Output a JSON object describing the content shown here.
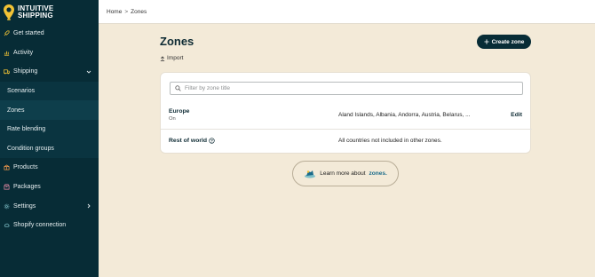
{
  "brand": {
    "line1": "INTUITIVE",
    "line2": "SHIPPING"
  },
  "sidebar": {
    "items": [
      {
        "label": "Get started",
        "icon": "rocket-icon"
      },
      {
        "label": "Activity",
        "icon": "chart-icon"
      },
      {
        "label": "Shipping",
        "icon": "truck-icon",
        "expanded": true
      },
      {
        "label": "Scenarios"
      },
      {
        "label": "Zones",
        "active": true
      },
      {
        "label": "Rate blending"
      },
      {
        "label": "Condition groups"
      },
      {
        "label": "Products",
        "icon": "gift-icon"
      },
      {
        "label": "Packages",
        "icon": "package-icon"
      },
      {
        "label": "Settings",
        "icon": "gear-icon"
      },
      {
        "label": "Shopify connection",
        "icon": "cloud-link-icon"
      }
    ]
  },
  "breadcrumb": {
    "home": "Home",
    "separator": ">",
    "current": "Zones"
  },
  "page": {
    "title": "Zones",
    "import_label": "Import",
    "create_label": "Create zone"
  },
  "search": {
    "placeholder": "Filter by zone title",
    "value": ""
  },
  "zones": [
    {
      "name": "Europe",
      "status": "On",
      "countries": "Aland Islands, Albania, Andorra, Austria, Belarus, ...",
      "action": "Edit"
    },
    {
      "name": "Rest of world",
      "status": "",
      "countries": "All countries not included in other zones.",
      "action": ""
    }
  ],
  "learn_more": {
    "text": "Learn more about",
    "link": "zones."
  },
  "colors": {
    "sidebar": "#072c36",
    "background": "#f3ead8",
    "accent_link": "#1a6b8a"
  }
}
